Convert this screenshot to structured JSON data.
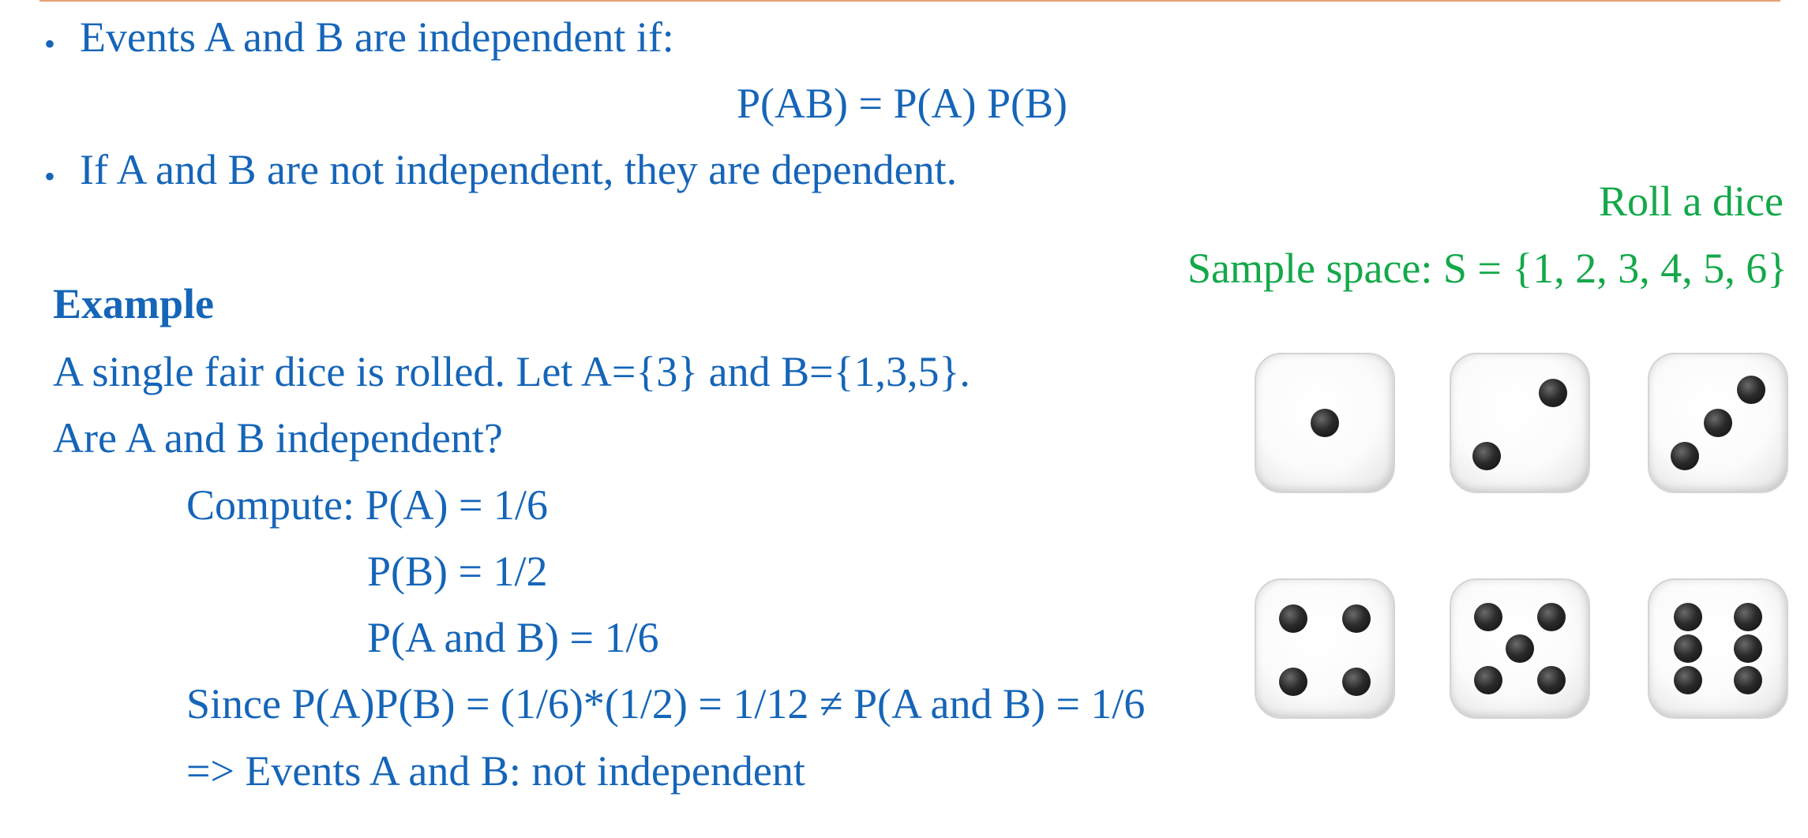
{
  "bullets": [
    {
      "text": "Events A and B are independent if:"
    },
    {
      "text": "If A and B are not independent, they are dependent."
    }
  ],
  "formula": "P(AB) = P(A) P(B)",
  "example": {
    "heading": "Example",
    "problem_line1": "A single fair dice is rolled. Let A={3} and B={1,3,5}.",
    "problem_line2": "Are A and B independent?",
    "compute_line1": "Compute: P(A) = 1/6",
    "compute_line2": "P(B) = 1/2",
    "compute_line3": "P(A and B) = 1/6",
    "since_line": "Since P(A)P(B) = (1/6)*(1/2) = 1/12 ≠ P(A and B) = 1/6",
    "conclusion": "=> Events A and B: not independent"
  },
  "dice_panel": {
    "title": "Roll a dice",
    "sample_space": "Sample space: S = {1, 2, 3, 4, 5, 6}",
    "faces": [
      1,
      2,
      3,
      4,
      5,
      6
    ]
  },
  "colors": {
    "text_blue": "#1565b8",
    "text_green": "#14a84a",
    "rule_orange": "#e8a070"
  }
}
